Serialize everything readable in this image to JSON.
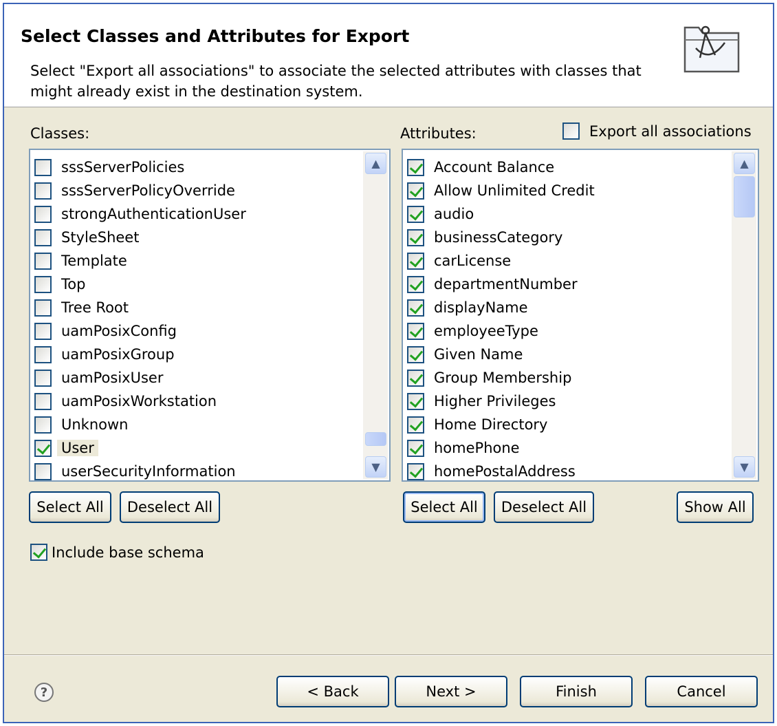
{
  "header": {
    "title": "Select Classes and Attributes for Export",
    "description": "Select \"Export all associations\" to associate the selected attributes with classes that might already exist in the destination system."
  },
  "classes": {
    "label": "Classes:",
    "items": [
      {
        "label": "sssServerPolicies",
        "checked": false
      },
      {
        "label": "sssServerPolicyOverride",
        "checked": false
      },
      {
        "label": "strongAuthenticationUser",
        "checked": false
      },
      {
        "label": "StyleSheet",
        "checked": false
      },
      {
        "label": "Template",
        "checked": false
      },
      {
        "label": "Top",
        "checked": false
      },
      {
        "label": "Tree Root",
        "checked": false
      },
      {
        "label": "uamPosixConfig",
        "checked": false
      },
      {
        "label": "uamPosixGroup",
        "checked": false
      },
      {
        "label": "uamPosixUser",
        "checked": false
      },
      {
        "label": "uamPosixWorkstation",
        "checked": false
      },
      {
        "label": "Unknown",
        "checked": false
      },
      {
        "label": "User",
        "checked": true,
        "selected": true
      },
      {
        "label": "userSecurityInformation",
        "checked": false
      }
    ],
    "select_all": "Select All",
    "deselect_all": "Deselect All"
  },
  "attributes": {
    "label": "Attributes:",
    "export_all_label": "Export all associations",
    "export_all_checked": false,
    "items": [
      {
        "label": "Account Balance",
        "checked": true
      },
      {
        "label": "Allow Unlimited Credit",
        "checked": true
      },
      {
        "label": "audio",
        "checked": true
      },
      {
        "label": "businessCategory",
        "checked": true
      },
      {
        "label": "carLicense",
        "checked": true
      },
      {
        "label": "departmentNumber",
        "checked": true
      },
      {
        "label": "displayName",
        "checked": true
      },
      {
        "label": "employeeType",
        "checked": true
      },
      {
        "label": "Given Name",
        "checked": true
      },
      {
        "label": "Group Membership",
        "checked": true
      },
      {
        "label": "Higher Privileges",
        "checked": true
      },
      {
        "label": "Home Directory",
        "checked": true
      },
      {
        "label": "homePhone",
        "checked": true
      },
      {
        "label": "homePostalAddress",
        "checked": true
      }
    ],
    "select_all": "Select All",
    "deselect_all": "Deselect All",
    "show_all": "Show All"
  },
  "include_base_schema": {
    "label": "Include base schema",
    "checked": true
  },
  "footer": {
    "help": "?",
    "back": "< Back",
    "next": "Next >",
    "finish": "Finish",
    "cancel": "Cancel"
  },
  "icons": {
    "scroll_up": "▲",
    "scroll_down": "▼"
  }
}
